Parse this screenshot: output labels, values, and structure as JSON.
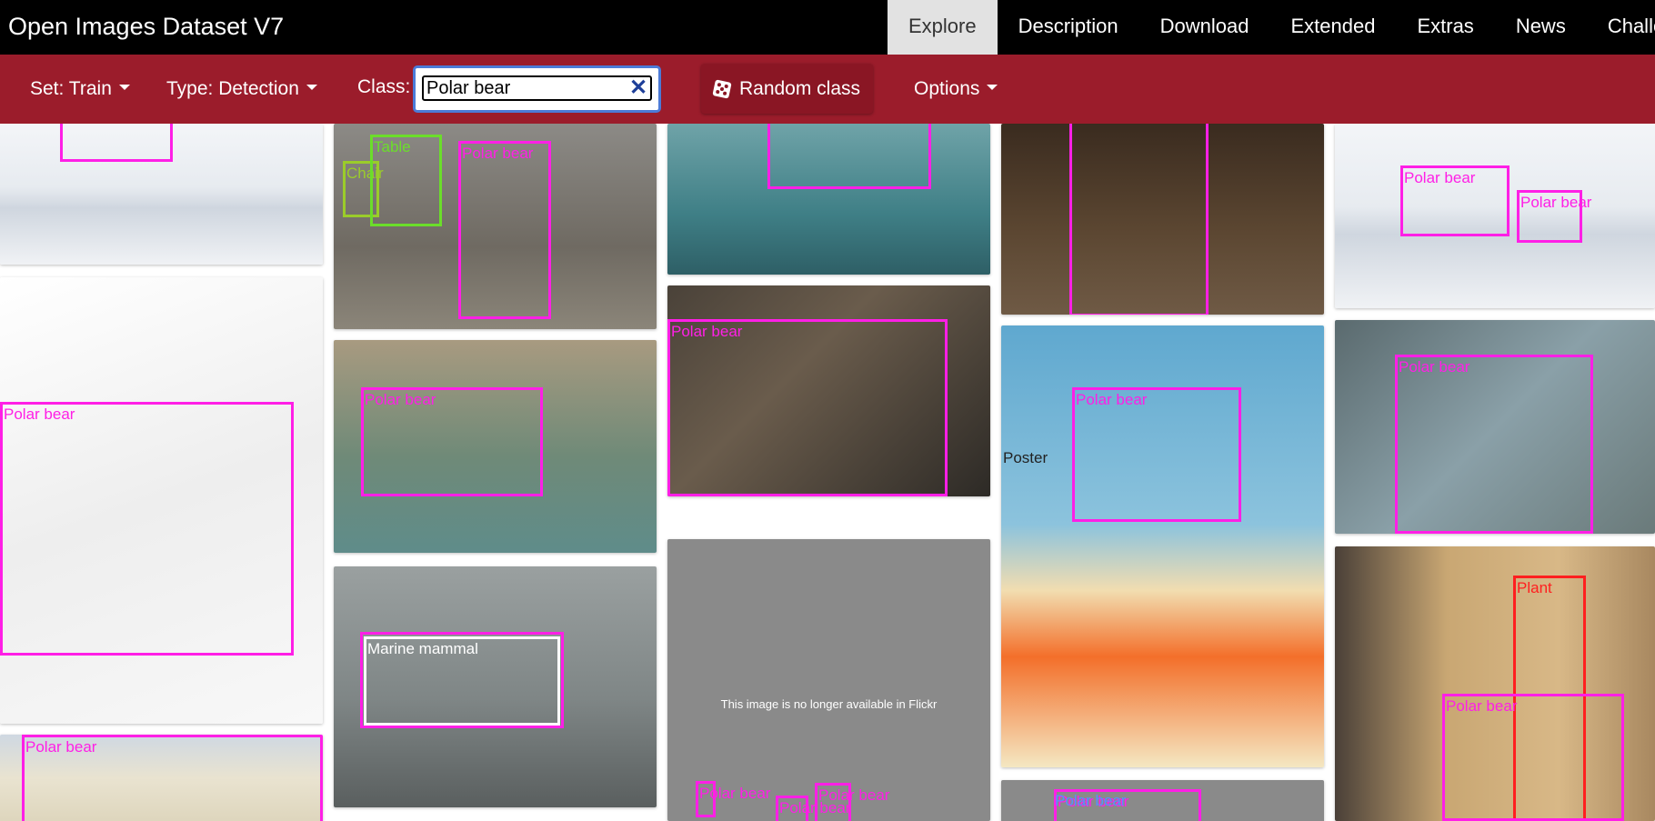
{
  "brand": "Open Images Dataset V7",
  "nav": {
    "items": [
      "Explore",
      "Description",
      "Download",
      "Extended",
      "Extras",
      "News",
      "Challenge"
    ],
    "active": "Explore"
  },
  "filters": {
    "set": "Set: Train",
    "type": "Type: Detection",
    "class_label": "Class:",
    "class_value": "Polar bear",
    "random_label": "Random class",
    "options": "Options"
  },
  "labels": {
    "polar_bear": "Polar bear",
    "table": "Table",
    "chair": "Chair",
    "marine_mammal": "Marine mammal",
    "poster": "Poster",
    "plant": "Plant",
    "not_available": "This image is no longer available in Flickr"
  },
  "colors": {
    "topbar": "#000000",
    "filterbar": "#9b1c2b",
    "accent_box": "#ff1fe6"
  },
  "icons": [
    "caret-down-icon",
    "dice-icon",
    "clear-icon"
  ]
}
